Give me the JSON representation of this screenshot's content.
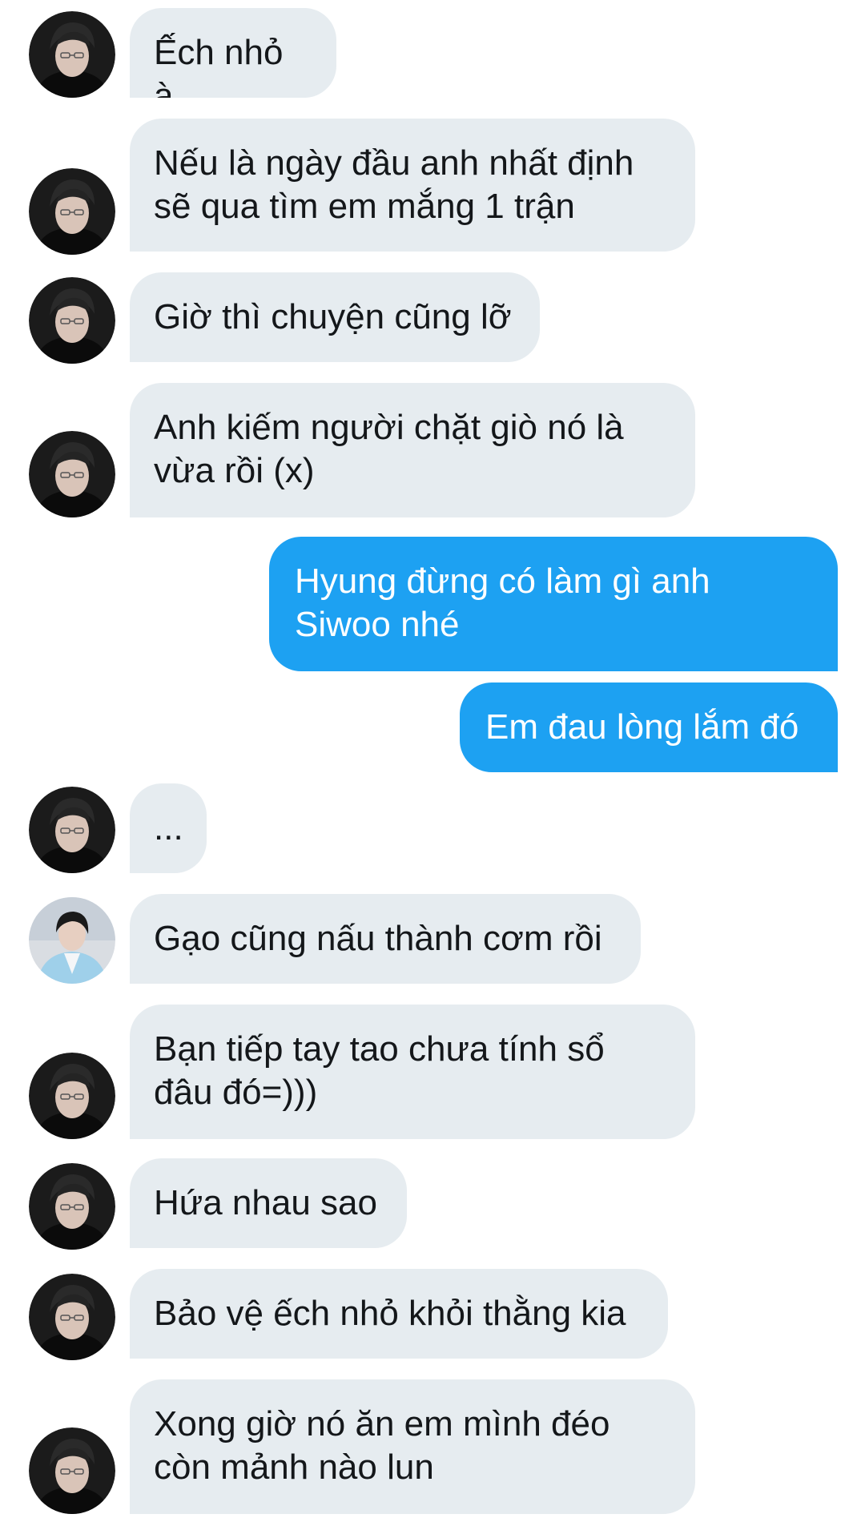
{
  "conversation": {
    "messages": [
      {
        "sender": "contact",
        "avatar": "dark-portrait-avatar",
        "text": "Ếch nhỏ à"
      },
      {
        "sender": "contact",
        "avatar": "dark-portrait-avatar",
        "text": "Nếu là ngày đầu anh nhất định\nsẽ qua tìm em mắng 1 trận"
      },
      {
        "sender": "contact",
        "avatar": "dark-portrait-avatar",
        "text": "Giờ thì chuyện cũng lỡ"
      },
      {
        "sender": "contact",
        "avatar": "dark-portrait-avatar",
        "text": "Anh kiếm người chặt giò nó là\nvừa rồi (x)"
      },
      {
        "sender": "self",
        "text": "Hyung đừng có làm gì anh\nSiwoo nhé"
      },
      {
        "sender": "self",
        "text": "Em đau lòng lắm đó"
      },
      {
        "sender": "contact",
        "avatar": "dark-portrait-avatar",
        "text": "..."
      },
      {
        "sender": "contact",
        "avatar": "blue-hanbok-avatar",
        "text": "Gạo cũng nấu thành cơm rồi"
      },
      {
        "sender": "contact",
        "avatar": "dark-portrait-avatar",
        "text": "Bạn tiếp tay tao chưa tính sổ\nđâu đó=)))"
      },
      {
        "sender": "contact",
        "avatar": "dark-portrait-avatar",
        "text": "Hứa nhau sao"
      },
      {
        "sender": "contact",
        "avatar": "dark-portrait-avatar",
        "text": "Bảo vệ ếch nhỏ khỏi thằng kia"
      },
      {
        "sender": "contact",
        "avatar": "dark-portrait-avatar",
        "text": "Xong giờ nó ăn em mình đéo\ncòn mảnh nào lun"
      }
    ]
  },
  "colors": {
    "incoming_bubble": "#e6ecf0",
    "outgoing_bubble": "#1da1f2",
    "incoming_text": "#14171a",
    "outgoing_text": "#ffffff"
  }
}
